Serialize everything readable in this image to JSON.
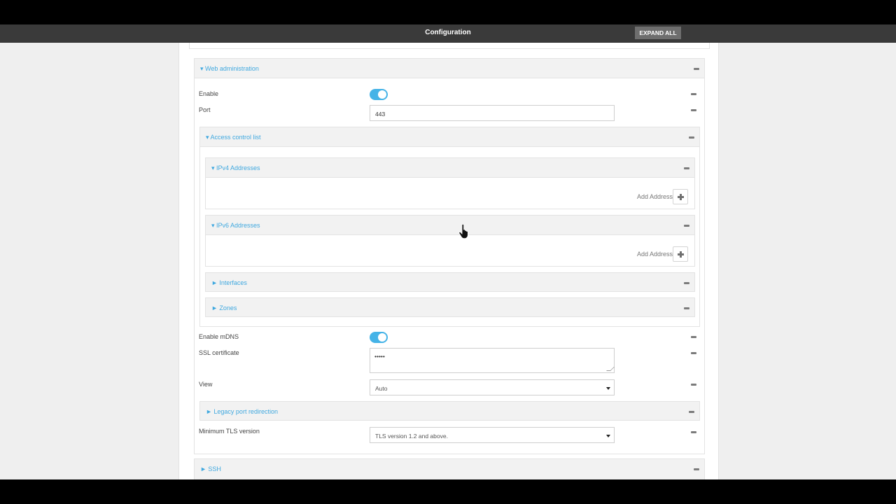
{
  "header": {
    "title": "Configuration",
    "expand_all_label": "EXPAND ALL"
  },
  "web_admin": {
    "title": "▾ Web administration",
    "enable_label": "Enable",
    "enable_on": true,
    "port_label": "Port",
    "port_value": "443",
    "acl": {
      "title": "▾ Access control list",
      "ipv4": {
        "title": "▾ IPv4 Addresses",
        "add_label": "Add Address"
      },
      "ipv6": {
        "title": "▾ IPv6 Addresses",
        "add_label": "Add Address"
      },
      "interfaces_title": "► Interfaces",
      "zones_title": "► Zones"
    },
    "mdns_label": "Enable mDNS",
    "mdns_on": true,
    "ssl_label": "SSL certificate",
    "ssl_value": "•••••",
    "view_label": "View",
    "view_value": "Auto",
    "legacy_title": "► Legacy port redirection",
    "tls_label": "Minimum TLS version",
    "tls_value": "TLS version 1.2 and above."
  },
  "ssh_title": "► SSH",
  "colors": {
    "accent": "#3fa8df",
    "toggle_on": "#45b3e7",
    "header_bg": "#3a3a3a"
  },
  "icons": {
    "collapse": "minus-icon",
    "add": "plus-icon",
    "cursor": "hand-pointer-icon"
  }
}
